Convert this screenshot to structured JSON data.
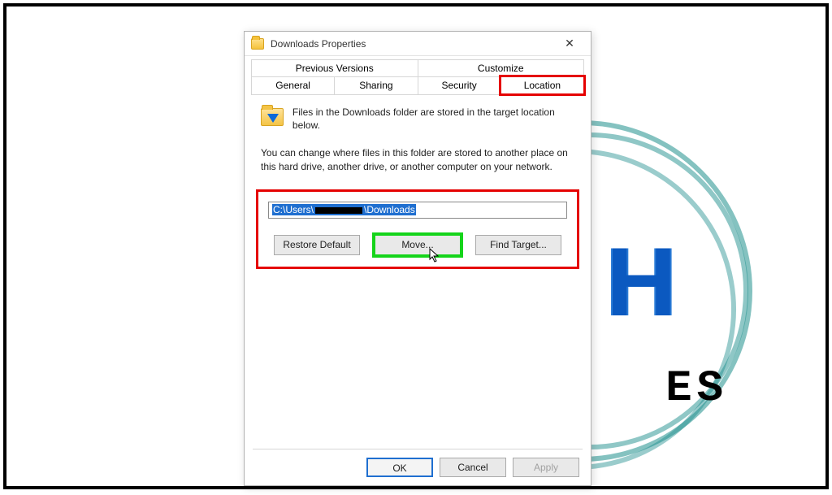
{
  "window": {
    "title": "Downloads Properties",
    "close_glyph": "✕"
  },
  "tabs": {
    "row1": [
      "Previous Versions",
      "Customize"
    ],
    "row2": [
      "General",
      "Sharing",
      "Security",
      "Location"
    ],
    "active": "Location"
  },
  "description": {
    "line": "Files in the Downloads folder are stored in the target location below."
  },
  "explain": "You can change where files in this folder are stored to another place on this hard drive, another drive, or another computer on your network.",
  "path": {
    "prefix": "C:\\Users\\",
    "redacted": true,
    "suffix": "\\Downloads"
  },
  "buttons": {
    "restore": "Restore Default",
    "move": "Move...",
    "find_target": "Find Target..."
  },
  "footer": {
    "ok": "OK",
    "cancel": "Cancel",
    "apply": "Apply"
  },
  "watermark": {
    "letter": "H",
    "suffix": "ES"
  }
}
